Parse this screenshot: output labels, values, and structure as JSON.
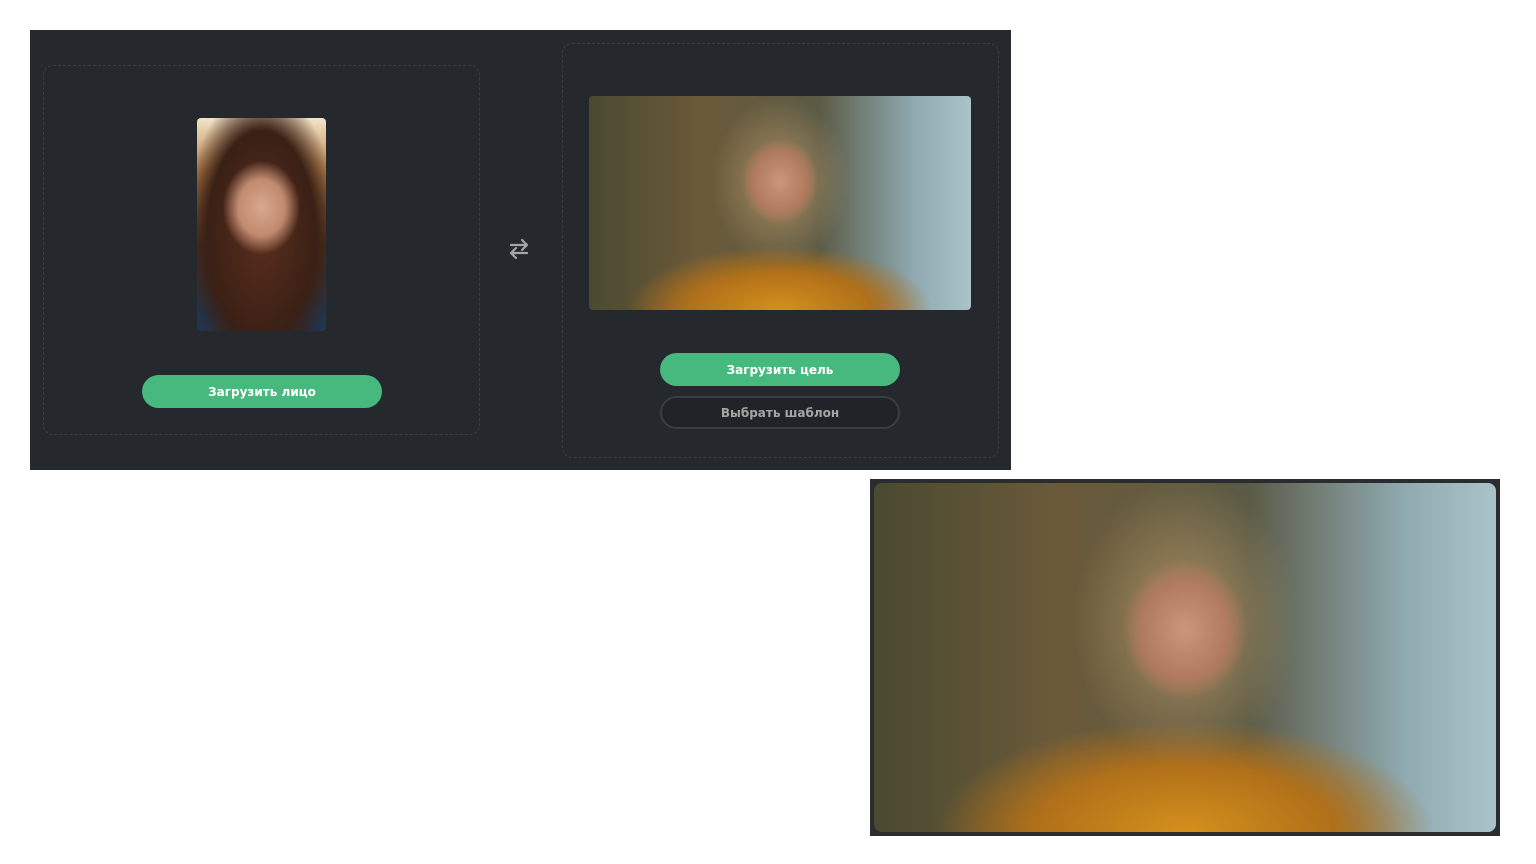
{
  "face_card": {
    "upload_label": "Загрузить лицо",
    "photo_icon": "face-photo"
  },
  "swap_icon": "swap-arrows-icon",
  "target_card": {
    "upload_label": "Загрузить цель",
    "template_label": "Выбрать шаблон"
  },
  "colors": {
    "panel": "#25282d",
    "accent": "#47b87e"
  }
}
